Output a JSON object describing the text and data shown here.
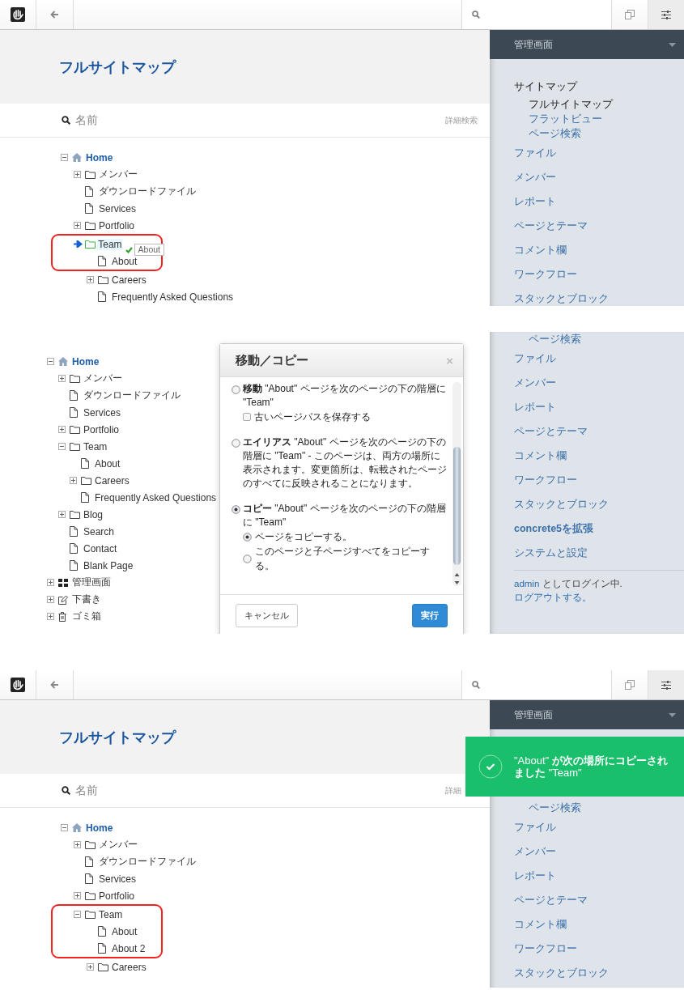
{
  "panels": [
    {
      "kind": "drag",
      "header": {
        "title": "フルサイトマップ",
        "search_placeholder": "名前",
        "advanced_search": "詳細検索"
      },
      "drag": {
        "helper": "About"
      },
      "tree": [
        {
          "label": "Home",
          "kind": "home",
          "expanded": true,
          "highlighted": false,
          "children": [
            {
              "label": "メンバー",
              "kind": "folder",
              "expanded": false,
              "highlighted": false
            },
            {
              "label": "ダウンロードファイル",
              "kind": "page",
              "highlighted": false
            },
            {
              "label": "Services",
              "kind": "page",
              "highlighted": false
            },
            {
              "label": "Portfolio",
              "kind": "folder",
              "expanded": false,
              "highlighted": false
            },
            {
              "label": "Team",
              "kind": "folder",
              "drop_target": true,
              "highlighted": true,
              "children": [
                {
                  "label": "About",
                  "kind": "page",
                  "highlighted": true
                },
                {
                  "label": "Careers",
                  "kind": "folder",
                  "expanded": false,
                  "highlighted": false
                },
                {
                  "label": "Frequently Asked Questions",
                  "kind": "page",
                  "highlighted": false
                }
              ]
            }
          ]
        }
      ],
      "sidebar": {
        "title": "管理画面",
        "items": [
          {
            "kind": "heading",
            "label": "サイトマップ"
          },
          {
            "kind": "sub",
            "label": "フルサイトマップ",
            "selected": true
          },
          {
            "kind": "sub",
            "label": "フラットビュー",
            "selected": false
          },
          {
            "kind": "sub",
            "label": "ページ検索",
            "selected": false
          },
          {
            "kind": "item",
            "label": "ファイル"
          },
          {
            "kind": "item",
            "label": "メンバー"
          },
          {
            "kind": "item",
            "label": "レポート"
          },
          {
            "kind": "item",
            "label": "ページとテーマ"
          },
          {
            "kind": "item",
            "label": "コメント欄"
          },
          {
            "kind": "item",
            "label": "ワークフロー"
          },
          {
            "kind": "item",
            "label": "スタックとブロック"
          }
        ]
      }
    },
    {
      "kind": "dialog",
      "tree": [
        {
          "label": "Home",
          "kind": "home",
          "expanded": true,
          "children": [
            {
              "label": "メンバー",
              "kind": "folder",
              "expanded": false
            },
            {
              "label": "ダウンロードファイル",
              "kind": "page"
            },
            {
              "label": "Services",
              "kind": "page"
            },
            {
              "label": "Portfolio",
              "kind": "folder",
              "expanded": false
            },
            {
              "label": "Team",
              "kind": "folder",
              "expanded": true,
              "children": [
                {
                  "label": "About",
                  "kind": "page"
                },
                {
                  "label": "Careers",
                  "kind": "folder",
                  "expanded": false
                },
                {
                  "label": "Frequently Asked Questions",
                  "kind": "page"
                }
              ]
            },
            {
              "label": "Blog",
              "kind": "folder",
              "expanded": false
            },
            {
              "label": "Search",
              "kind": "page"
            },
            {
              "label": "Contact",
              "kind": "page"
            },
            {
              "label": "Blank Page",
              "kind": "page"
            }
          ]
        },
        {
          "label": "管理画面",
          "kind": "grid",
          "expanded": false
        },
        {
          "label": "下書き",
          "kind": "edit",
          "expanded": false
        },
        {
          "label": "ゴミ箱",
          "kind": "trash",
          "expanded": false
        }
      ],
      "dialog": {
        "title": "移動／コピー",
        "close": "×",
        "options": [
          {
            "text": "**移動** \"About\" ページを次のページの下の階層に \"Team\"",
            "selected": false,
            "sub": [
              {
                "kind": "checkbox",
                "label": "古いページパスを保存する",
                "checked": false
              }
            ]
          },
          {
            "text": "**エイリアス** \"About\" ページを次のページの下の階層に \"Team\" - このページは、両方の場所に表示されます。変更箇所は、転載されたページのすべてに反映されることになります。",
            "selected": false
          },
          {
            "text": "**コピー** \"About\" ページを次のページの下の階層に \"Team\"",
            "selected": true,
            "sub": [
              {
                "kind": "radio",
                "label": "ページをコピーする。",
                "selected": true
              },
              {
                "kind": "radio",
                "label": "このページと子ページすべてをコピーする。",
                "selected": false
              }
            ]
          }
        ],
        "cancel": "キャンセル",
        "submit": "実行"
      },
      "sidebar": {
        "items": [
          {
            "kind": "sub",
            "label": "ページ検索",
            "selected": false
          },
          {
            "kind": "item",
            "label": "ファイル"
          },
          {
            "kind": "item",
            "label": "メンバー"
          },
          {
            "kind": "item",
            "label": "レポート"
          },
          {
            "kind": "item",
            "label": "ページとテーマ"
          },
          {
            "kind": "item",
            "label": "コメント欄"
          },
          {
            "kind": "item",
            "label": "ワークフロー"
          },
          {
            "kind": "item",
            "label": "スタックとブロック"
          },
          {
            "kind": "strong",
            "label": "concrete5を拡張"
          },
          {
            "kind": "item",
            "label": "システムと設定"
          }
        ],
        "login": {
          "user": "admin",
          "text": "としてログイン中."
        },
        "logout": "ログアウトする。"
      }
    },
    {
      "kind": "toast",
      "header": {
        "title": "フルサイトマップ",
        "search_placeholder": "名前",
        "advanced_search": "詳細"
      },
      "toast": {
        "text": "\"About\" **が次の場所にコピーされました** \"Team\""
      },
      "tree": [
        {
          "label": "Home",
          "kind": "home",
          "expanded": true,
          "highlighted": false,
          "children": [
            {
              "label": "メンバー",
              "kind": "folder",
              "expanded": false,
              "highlighted": false
            },
            {
              "label": "ダウンロードファイル",
              "kind": "page",
              "highlighted": false
            },
            {
              "label": "Services",
              "kind": "page",
              "highlighted": false
            },
            {
              "label": "Portfolio",
              "kind": "folder",
              "expanded": false,
              "highlighted": false
            },
            {
              "label": "Team",
              "kind": "folder",
              "expanded": true,
              "highlighted": true,
              "children": [
                {
                  "label": "About",
                  "kind": "page",
                  "highlighted": true
                },
                {
                  "label": "About 2",
                  "kind": "page",
                  "highlighted": true
                },
                {
                  "label": "Careers",
                  "kind": "folder",
                  "expanded": false,
                  "highlighted": false
                }
              ]
            }
          ]
        }
      ],
      "sidebar": {
        "title": "管理画面",
        "items": [
          {
            "kind": "sub",
            "label": "ページ検索",
            "selected": false
          },
          {
            "kind": "item",
            "label": "ファイル"
          },
          {
            "kind": "item",
            "label": "メンバー"
          },
          {
            "kind": "item",
            "label": "レポート"
          },
          {
            "kind": "item",
            "label": "ページとテーマ"
          },
          {
            "kind": "item",
            "label": "コメント欄"
          },
          {
            "kind": "item",
            "label": "ワークフロー"
          },
          {
            "kind": "item",
            "label": "スタックとブロック"
          }
        ]
      }
    }
  ]
}
